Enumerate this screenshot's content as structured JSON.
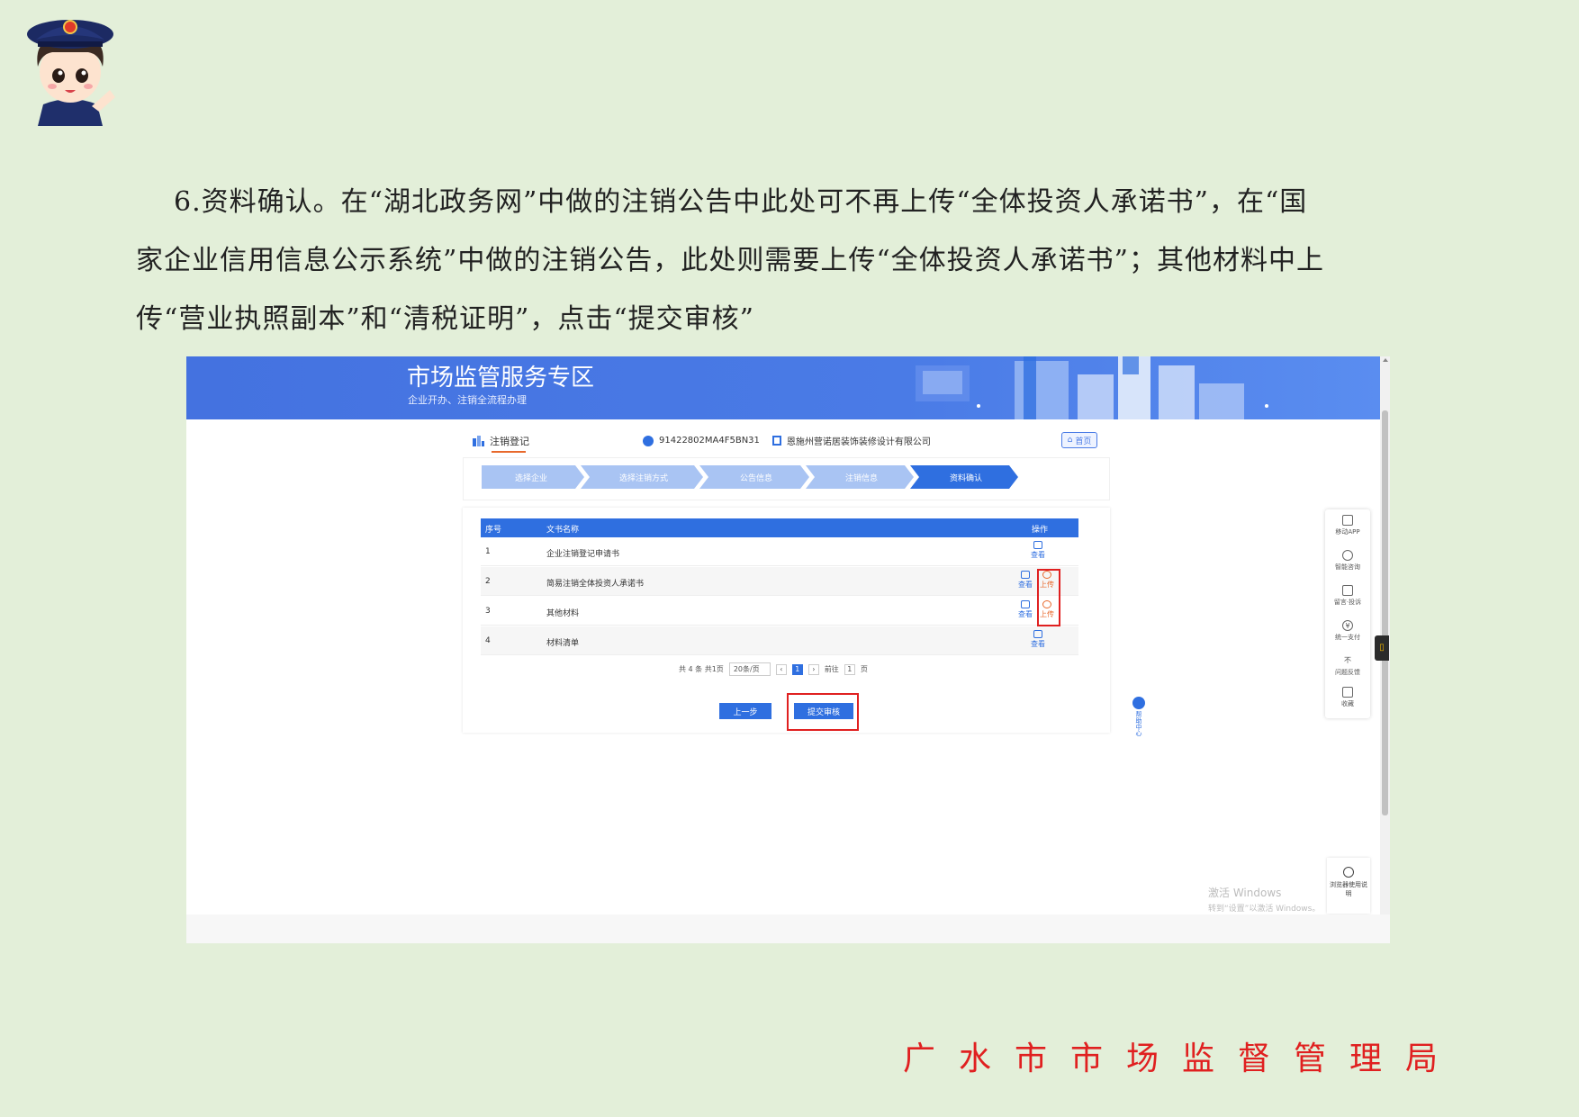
{
  "doc": {
    "paragraph_line1": "6.资料确认。在“湖北政务网”中做的注销公告中此处可不再上传“全体投资人承诺书”，在“国",
    "paragraph_line2": "家企业信用信息公示系统”中做的注销公告，此处则需要上传“全体投资人承诺书”；其他材料中上",
    "paragraph_line3": "传“营业执照副本”和“清税证明”，点击“提交审核”",
    "footer": "广水市市场监督管理局"
  },
  "app": {
    "banner_title": "市场监管服务专区",
    "banner_subtitle": "企业开办、注销全流程办理",
    "section_title": "注销登记",
    "credit_code": "91422802MA4F5BN31",
    "company_name": "恩施州营诺居装饰装修设计有限公司",
    "home_label": "首页"
  },
  "steps": [
    "选择企业",
    "选择注销方式",
    "公告信息",
    "注销信息",
    "资料确认"
  ],
  "table": {
    "headers": [
      "序号",
      "文书名称",
      "操作"
    ],
    "rows": [
      {
        "no": "1",
        "name": "企业注销登记申请书",
        "ops": [
          "查看"
        ]
      },
      {
        "no": "2",
        "name": "简易注销全体投资人承诺书",
        "ops": [
          "查看",
          "上传"
        ]
      },
      {
        "no": "3",
        "name": "其他材料",
        "ops": [
          "查看",
          "上传"
        ]
      },
      {
        "no": "4",
        "name": "材料清单",
        "ops": [
          "查看"
        ]
      }
    ]
  },
  "pager": {
    "total": "共 4 条  共1页",
    "page_size": "20条/页",
    "current_page": "1",
    "goto_label": "前往",
    "goto_value": "1",
    "page_suffix": "页"
  },
  "buttons": {
    "prev": "上一步",
    "submit": "提交审核"
  },
  "side_panel": [
    "移动APP",
    "智能咨询",
    "留言·投诉",
    "统一支付",
    "问题反馈",
    "收藏"
  ],
  "side_tab_icon": "sticky-note-icon",
  "vertical_help": "帮助中心",
  "help_box": "浏览器使用说明",
  "watermark": {
    "line1": "激活 Windows",
    "line2": "转到“设置”以激活 Windows。"
  },
  "colors": {
    "page_bg": "#e3efd9",
    "brand_blue": "#2f6fe0",
    "banner_blue": "#4472e0",
    "step_inactive": "#a9c4f3",
    "step_active": "#2f6fe0",
    "upload_orange": "#e8692c",
    "highlight_red": "#e02020"
  }
}
